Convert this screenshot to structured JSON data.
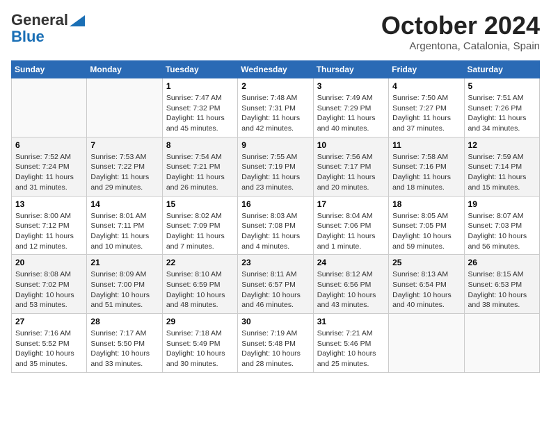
{
  "header": {
    "logo_general": "General",
    "logo_blue": "Blue",
    "month_title": "October 2024",
    "location": "Argentona, Catalonia, Spain"
  },
  "columns": [
    "Sunday",
    "Monday",
    "Tuesday",
    "Wednesday",
    "Thursday",
    "Friday",
    "Saturday"
  ],
  "weeks": [
    [
      {
        "day": "",
        "info": ""
      },
      {
        "day": "",
        "info": ""
      },
      {
        "day": "1",
        "sunrise": "7:47 AM",
        "sunset": "7:32 PM",
        "daylight": "11 hours and 45 minutes."
      },
      {
        "day": "2",
        "sunrise": "7:48 AM",
        "sunset": "7:31 PM",
        "daylight": "11 hours and 42 minutes."
      },
      {
        "day": "3",
        "sunrise": "7:49 AM",
        "sunset": "7:29 PM",
        "daylight": "11 hours and 40 minutes."
      },
      {
        "day": "4",
        "sunrise": "7:50 AM",
        "sunset": "7:27 PM",
        "daylight": "11 hours and 37 minutes."
      },
      {
        "day": "5",
        "sunrise": "7:51 AM",
        "sunset": "7:26 PM",
        "daylight": "11 hours and 34 minutes."
      }
    ],
    [
      {
        "day": "6",
        "sunrise": "7:52 AM",
        "sunset": "7:24 PM",
        "daylight": "11 hours and 31 minutes."
      },
      {
        "day": "7",
        "sunrise": "7:53 AM",
        "sunset": "7:22 PM",
        "daylight": "11 hours and 29 minutes."
      },
      {
        "day": "8",
        "sunrise": "7:54 AM",
        "sunset": "7:21 PM",
        "daylight": "11 hours and 26 minutes."
      },
      {
        "day": "9",
        "sunrise": "7:55 AM",
        "sunset": "7:19 PM",
        "daylight": "11 hours and 23 minutes."
      },
      {
        "day": "10",
        "sunrise": "7:56 AM",
        "sunset": "7:17 PM",
        "daylight": "11 hours and 20 minutes."
      },
      {
        "day": "11",
        "sunrise": "7:58 AM",
        "sunset": "7:16 PM",
        "daylight": "11 hours and 18 minutes."
      },
      {
        "day": "12",
        "sunrise": "7:59 AM",
        "sunset": "7:14 PM",
        "daylight": "11 hours and 15 minutes."
      }
    ],
    [
      {
        "day": "13",
        "sunrise": "8:00 AM",
        "sunset": "7:12 PM",
        "daylight": "11 hours and 12 minutes."
      },
      {
        "day": "14",
        "sunrise": "8:01 AM",
        "sunset": "7:11 PM",
        "daylight": "11 hours and 10 minutes."
      },
      {
        "day": "15",
        "sunrise": "8:02 AM",
        "sunset": "7:09 PM",
        "daylight": "11 hours and 7 minutes."
      },
      {
        "day": "16",
        "sunrise": "8:03 AM",
        "sunset": "7:08 PM",
        "daylight": "11 hours and 4 minutes."
      },
      {
        "day": "17",
        "sunrise": "8:04 AM",
        "sunset": "7:06 PM",
        "daylight": "11 hours and 1 minute."
      },
      {
        "day": "18",
        "sunrise": "8:05 AM",
        "sunset": "7:05 PM",
        "daylight": "10 hours and 59 minutes."
      },
      {
        "day": "19",
        "sunrise": "8:07 AM",
        "sunset": "7:03 PM",
        "daylight": "10 hours and 56 minutes."
      }
    ],
    [
      {
        "day": "20",
        "sunrise": "8:08 AM",
        "sunset": "7:02 PM",
        "daylight": "10 hours and 53 minutes."
      },
      {
        "day": "21",
        "sunrise": "8:09 AM",
        "sunset": "7:00 PM",
        "daylight": "10 hours and 51 minutes."
      },
      {
        "day": "22",
        "sunrise": "8:10 AM",
        "sunset": "6:59 PM",
        "daylight": "10 hours and 48 minutes."
      },
      {
        "day": "23",
        "sunrise": "8:11 AM",
        "sunset": "6:57 PM",
        "daylight": "10 hours and 46 minutes."
      },
      {
        "day": "24",
        "sunrise": "8:12 AM",
        "sunset": "6:56 PM",
        "daylight": "10 hours and 43 minutes."
      },
      {
        "day": "25",
        "sunrise": "8:13 AM",
        "sunset": "6:54 PM",
        "daylight": "10 hours and 40 minutes."
      },
      {
        "day": "26",
        "sunrise": "8:15 AM",
        "sunset": "6:53 PM",
        "daylight": "10 hours and 38 minutes."
      }
    ],
    [
      {
        "day": "27",
        "sunrise": "7:16 AM",
        "sunset": "5:52 PM",
        "daylight": "10 hours and 35 minutes."
      },
      {
        "day": "28",
        "sunrise": "7:17 AM",
        "sunset": "5:50 PM",
        "daylight": "10 hours and 33 minutes."
      },
      {
        "day": "29",
        "sunrise": "7:18 AM",
        "sunset": "5:49 PM",
        "daylight": "10 hours and 30 minutes."
      },
      {
        "day": "30",
        "sunrise": "7:19 AM",
        "sunset": "5:48 PM",
        "daylight": "10 hours and 28 minutes."
      },
      {
        "day": "31",
        "sunrise": "7:21 AM",
        "sunset": "5:46 PM",
        "daylight": "10 hours and 25 minutes."
      },
      {
        "day": "",
        "info": ""
      },
      {
        "day": "",
        "info": ""
      }
    ]
  ]
}
